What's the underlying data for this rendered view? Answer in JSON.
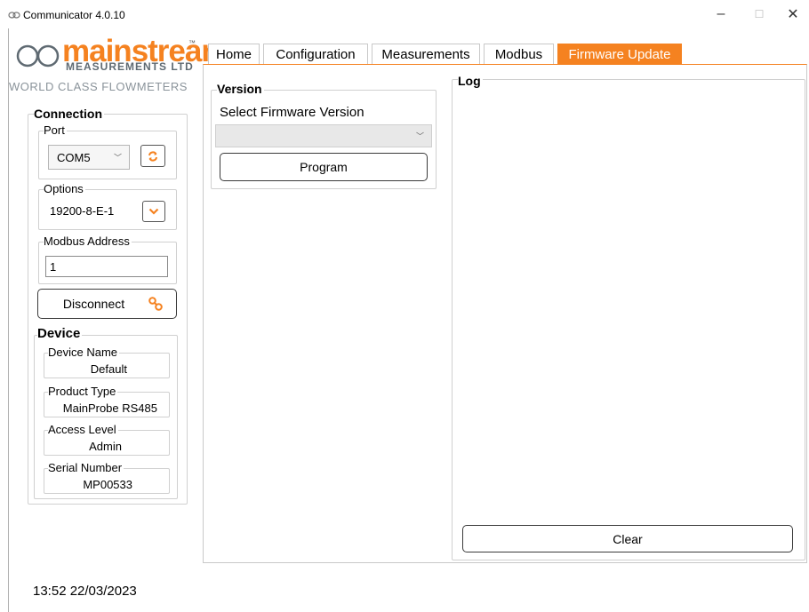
{
  "window": {
    "title": "Communicator 4.0.10",
    "minimize": "–",
    "maximize": "☐",
    "close": "✕"
  },
  "logo": {
    "brand": "mainstream",
    "tm": "™",
    "sub": "MEASUREMENTS LTD",
    "tagline": "WORLD CLASS FLOWMETERS",
    "brand_color": "#f58220"
  },
  "connection": {
    "title": "Connection",
    "port": {
      "label": "Port",
      "value": "COM5"
    },
    "options": {
      "label": "Options",
      "value": "19200-8-E-1"
    },
    "modbus": {
      "label": "Modbus Address",
      "value": "1"
    },
    "disconnect_label": "Disconnect"
  },
  "device": {
    "title": "Device",
    "fields": [
      {
        "label": "Device Name",
        "value": "Default"
      },
      {
        "label": "Product Type",
        "value": "MainProbe RS485"
      },
      {
        "label": "Access Level",
        "value": "Admin"
      },
      {
        "label": "Serial Number",
        "value": "MP00533"
      }
    ]
  },
  "tabs": [
    {
      "label": "Home",
      "active": false
    },
    {
      "label": "Configuration",
      "active": false
    },
    {
      "label": "Measurements",
      "active": false
    },
    {
      "label": "Modbus",
      "active": false
    },
    {
      "label": "Firmware Update",
      "active": true
    }
  ],
  "firmware": {
    "version_title": "Version",
    "select_label": "Select Firmware Version",
    "select_value": "",
    "program_label": "Program",
    "log_title": "Log",
    "clear_label": "Clear"
  },
  "status": {
    "datetime": "13:52 22/03/2023"
  },
  "icons": {
    "app": "link-icon",
    "refresh": "refresh-icon",
    "dropdown": "chevron-down-icon",
    "disconnect": "chain-link-icon"
  }
}
